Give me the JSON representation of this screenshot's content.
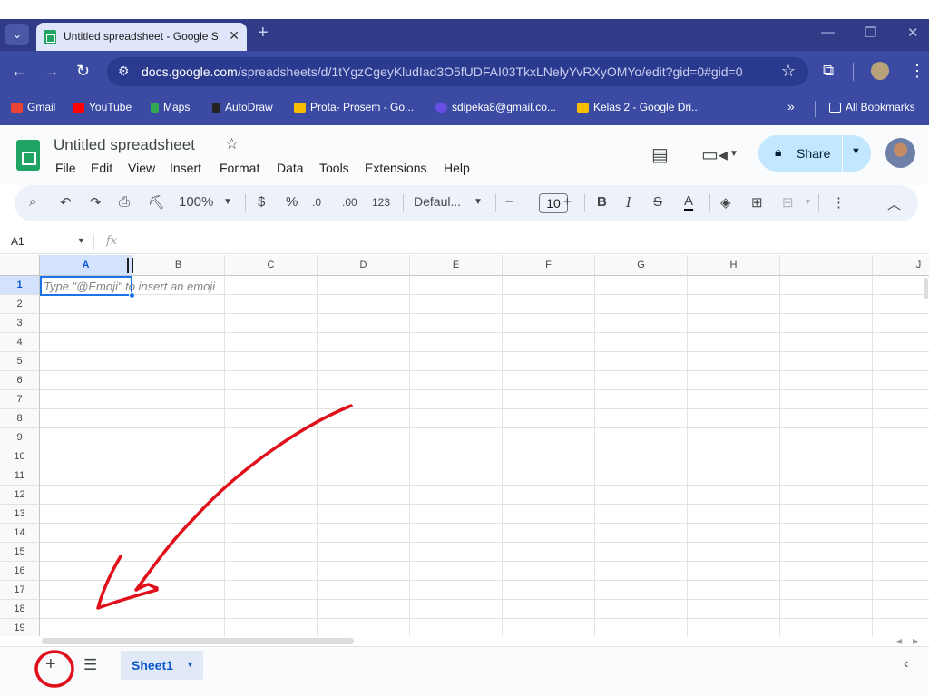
{
  "browser": {
    "tab_title": "Untitled spreadsheet - Google Sheets",
    "tab_close": "✕",
    "new_tab": "+",
    "url_host": "docs.google.com",
    "url_path": "/spreadsheets/d/1tYgzCgeyKludIad3O5fUDFAI03TkxLNelyYvRXyOMYo/edit?gid=0#gid=0",
    "bookmarks": [
      "Gmail",
      "YouTube",
      "Maps",
      "AutoDraw",
      "Prota- Prosem - Go...",
      "sdipeka8@gmail.co...",
      "Kelas 2 - Google Dri..."
    ],
    "bookmarks_overflow": "»",
    "all_bookmarks": "All Bookmarks"
  },
  "sheets": {
    "doc_title": "Untitled spreadsheet",
    "menu": [
      "File",
      "Edit",
      "View",
      "Insert",
      "Format",
      "Data",
      "Tools",
      "Extensions",
      "Help"
    ],
    "share_label": "Share",
    "toolbar": {
      "zoom": "100%",
      "currency": "$",
      "percent": "%",
      "dec_decrease": ".0",
      "dec_increase": ".00",
      "number_format": "123",
      "font": "Defaul...",
      "font_size": "10"
    },
    "name_box": "A1",
    "fx_label": "fx",
    "columns": [
      "A",
      "B",
      "C",
      "D",
      "E",
      "F",
      "G",
      "H",
      "I",
      "J"
    ],
    "rows": [
      "1",
      "2",
      "3",
      "4",
      "5",
      "6",
      "7",
      "8",
      "9",
      "10",
      "11",
      "12",
      "13",
      "14",
      "15",
      "16",
      "17",
      "18",
      "19"
    ],
    "cell_hint": "Type \"@Emoji\" to insert an emoji",
    "sheet_tab": "Sheet1"
  },
  "colors": {
    "chrome_tabstrip": "#2f3b86",
    "chrome_toolbar": "#3b4ba3",
    "sheets_green": "#1fa463",
    "selection_blue": "#1a73e8",
    "annotation_red": "#e0101a"
  }
}
